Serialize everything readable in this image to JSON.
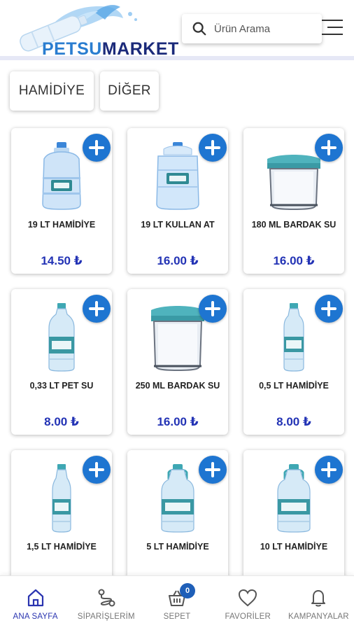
{
  "brand": {
    "part1": "PETSU",
    "part2": "MARKET"
  },
  "search": {
    "placeholder": "Ürün Arama"
  },
  "categories": [
    "HAMİDİYE",
    "DİĞER"
  ],
  "products": [
    {
      "name": "19 LT HAMİDİYE",
      "price": "14.50 ₺",
      "image": "19l-bottle"
    },
    {
      "name": "19 LT KULLAN AT",
      "price": "16.00 ₺",
      "image": "19l-disposable"
    },
    {
      "name": "180 ML BARDAK SU",
      "price": "16.00 ₺",
      "image": "cup-pack"
    },
    {
      "name": "0,33 LT PET SU",
      "price": "8.00 ₺",
      "image": "small-bottle"
    },
    {
      "name": "250 ML BARDAK SU",
      "price": "16.00 ₺",
      "image": "cup-pack"
    },
    {
      "name": "0,5 LT HAMİDİYE",
      "price": "8.00 ₺",
      "image": "slim-bottle"
    },
    {
      "name": "1,5 LT HAMİDİYE",
      "price": "",
      "image": "tall-bottle"
    },
    {
      "name": "5 LT HAMİDİYE",
      "price": "",
      "image": "jug"
    },
    {
      "name": "10 LT HAMİDİYE",
      "price": "",
      "image": "jug"
    }
  ],
  "nav": [
    {
      "label": "ANA SAYFA",
      "icon": "home-icon",
      "active": true
    },
    {
      "label": "SİPARİŞLERİM",
      "icon": "route-icon"
    },
    {
      "label": "SEPET",
      "icon": "basket-icon",
      "badge": "0"
    },
    {
      "label": "FAVORİLER",
      "icon": "heart-icon"
    },
    {
      "label": "KAMPANYALAR",
      "icon": "bell-icon"
    }
  ],
  "colors": {
    "accent": "#1e75d1",
    "price": "#2333b5",
    "active_nav": "#2a34b0"
  }
}
